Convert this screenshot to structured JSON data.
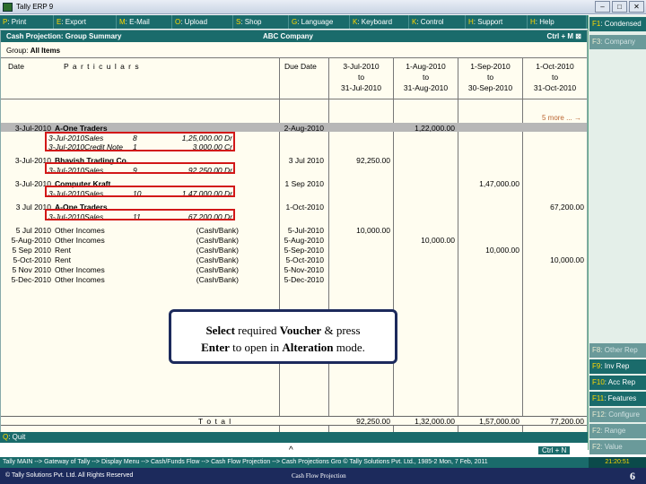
{
  "window": {
    "title": "Tally ERP 9"
  },
  "topbar": [
    {
      "key": "P",
      "label": ": Print"
    },
    {
      "key": "E",
      "label": ": Export"
    },
    {
      "key": "M",
      "label": ": E-Mail"
    },
    {
      "key": "O",
      "label": ": Upload"
    },
    {
      "key": "S",
      "label": ": Shop"
    },
    {
      "key": "G",
      "label": ": Language"
    },
    {
      "key": "K",
      "label": ": Keyboard"
    },
    {
      "key": "K",
      "label": ": Control Centre"
    },
    {
      "key": "H",
      "label": ": Support Centre"
    },
    {
      "key": "H",
      "label": ": Help"
    }
  ],
  "header": {
    "title": "Cash Projection: Group Summary",
    "company": "ABC Company",
    "shortcut": "Ctrl + M",
    "close": "⊠"
  },
  "group": {
    "label": "Group:",
    "name": "All Items"
  },
  "columns": {
    "date": "Date",
    "particulars": "P a r t i c u l a r s",
    "due": "Due Date",
    "periods": [
      {
        "from": "3-Jul-2010",
        "to": "to",
        "end": "31-Jul-2010"
      },
      {
        "from": "1-Aug-2010",
        "to": "to",
        "end": "31-Aug-2010"
      },
      {
        "from": "1-Sep-2010",
        "to": "to",
        "end": "30-Sep-2010"
      },
      {
        "from": "1-Oct-2010",
        "to": "to",
        "end": "31-Oct-2010"
      }
    ]
  },
  "more": "5 more ... →",
  "rows": [
    {
      "date": "3-Jul-2010",
      "name": "A-One Traders",
      "due": "2-Aug-2010",
      "p1": "",
      "p2": "1,22,000.00",
      "p3": "",
      "p4": ""
    },
    {
      "date": "3-Jul-2010",
      "name": "Sales",
      "no": "8",
      "amt": "1,25,000.00 Dr"
    },
    {
      "date": "3-Jul-2010",
      "name": "Credit Note",
      "no": "1",
      "amt": "3,000.00 Cr"
    },
    {
      "date": "3-Jul-2010",
      "name": "Bhavish Trading Co.",
      "due": "3 Jul 2010",
      "p1": "92,250.00",
      "p2": "",
      "p3": "",
      "p4": ""
    },
    {
      "date": "3-Jul-2010",
      "name": "Sales",
      "no": "9",
      "amt": "92,250.00 Dr"
    },
    {
      "date": "3-Jul-2010",
      "name": "Computer Kraft",
      "due": "1 Sep 2010",
      "p1": "",
      "p2": "",
      "p3": "1,47,000.00",
      "p4": ""
    },
    {
      "date": "3-Jul-2010",
      "name": "Sales",
      "no": "10",
      "amt": "1,47,000.00 Dr"
    },
    {
      "date": "3 Jul 2010",
      "name": "A-One Traders",
      "due": "1-Oct-2010",
      "p1": "",
      "p2": "",
      "p3": "",
      "p4": "67,200.00"
    },
    {
      "date": "3-Jul-2010",
      "name": "Sales",
      "no": "11",
      "amt": "67,200.00 Dr"
    },
    {
      "date": "5 Jul 2010",
      "name": "Other Incomes",
      "mode": "(Cash/Bank)",
      "due": "5-Jul-2010",
      "p1": "10,000.00",
      "p2": "",
      "p3": "",
      "p4": ""
    },
    {
      "date": "5-Aug-2010",
      "name": "Other Incomes",
      "mode": "(Cash/Bank)",
      "due": "5-Aug-2010",
      "p1": "",
      "p2": "10,000.00",
      "p3": "",
      "p4": ""
    },
    {
      "date": "5 Sep 2010",
      "name": "Rent",
      "mode": "(Cash/Bank)",
      "due": "5-Sep-2010",
      "p1": "",
      "p2": "",
      "p3": "10,000.00",
      "p4": ""
    },
    {
      "date": "5-Oct-2010",
      "name": "Rent",
      "mode": "(Cash/Bank)",
      "due": "5-Oct-2010",
      "p1": "",
      "p2": "",
      "p3": "",
      "p4": "10,000.00"
    },
    {
      "date": "5 Nov 2010",
      "name": "Other Incomes",
      "mode": "(Cash/Bank)",
      "due": "5-Nov-2010",
      "p1": "",
      "p2": "",
      "p3": "",
      "p4": ""
    },
    {
      "date": "5-Dec-2010",
      "name": "Other Incomes",
      "mode": "(Cash/Bank)",
      "due": "5-Dec-2010",
      "p1": "",
      "p2": "",
      "p3": "",
      "p4": ""
    }
  ],
  "total": {
    "label": "T o t a l",
    "p1": "92,250.00",
    "p2": "1,32,000.00",
    "p3": "1,57,000.00",
    "p4": "77,200.00"
  },
  "quit": {
    "key": "Q",
    "label": ": Quit"
  },
  "ctrl_n": "Ctrl + N",
  "rightpanel": [
    {
      "key": "F1",
      "label": ": Condensed",
      "active": true
    },
    {
      "key": "F3",
      "label": ": Company",
      "active": false
    },
    {
      "key": "F8",
      "label": ": Other Rep",
      "active": false
    },
    {
      "key": "F9",
      "label": ": Inv Rep",
      "active": true
    },
    {
      "key": "F10",
      "label": ": Acc Rep",
      "active": true
    },
    {
      "key": "F11",
      "label": ": Features",
      "active": true
    },
    {
      "key": "F12",
      "label": ": Configure",
      "active": false
    },
    {
      "key": "F2",
      "label": ": Range",
      "active": false
    },
    {
      "key": "F2",
      "label": ": Value",
      "active": false
    }
  ],
  "tooltip": {
    "w1": "Select",
    "t1": " required ",
    "w2": "Voucher",
    "t2": " & press",
    "w3": "Enter",
    "t3": " to open in ",
    "w4": "Alteration",
    "t4": " mode."
  },
  "pathbar": {
    "path": "Tally MAIN --> Gateway of Tally --> Display Menu --> Cash/Funds Flow --> Cash Flow Projection --> Cash Projections Gro © Tally Solutions Pvt. Ltd., 1985-2 Mon, 7 Feb, 2011",
    "time": "21:20:51"
  },
  "footer": {
    "left": "© Tally Solutions Pvt. Ltd. All Rights Reserved",
    "center": "Cash Flow Projection",
    "page": "6"
  }
}
